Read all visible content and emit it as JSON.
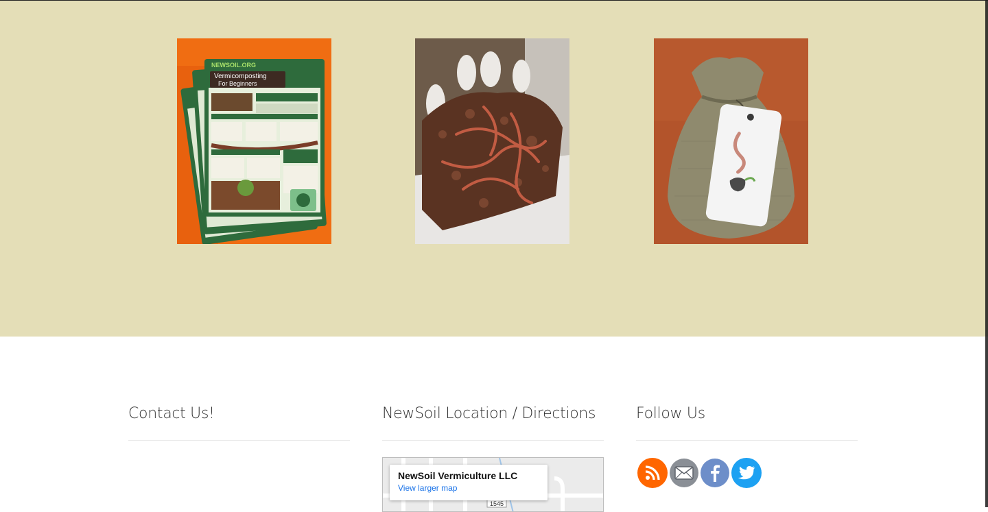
{
  "gallery": {
    "tiles": [
      {
        "title_line1": "NEWSOIL.ORG",
        "title_line2": "Vermicomposting",
        "title_line3": "For Beginners"
      },
      {},
      {}
    ]
  },
  "footer": {
    "contact": {
      "heading": "Contact Us!"
    },
    "location": {
      "heading": "NewSoil Location / Directions",
      "map_place": "NewSoil Vermiculture LLC",
      "map_link": "View larger map",
      "road_label": "1545"
    },
    "follow": {
      "heading": "Follow Us",
      "icons": [
        "rss-icon",
        "email-icon",
        "facebook-icon",
        "twitter-icon"
      ]
    }
  },
  "colors": {
    "band": "#e4deb7",
    "rss": "#ff6600",
    "email": "#8a8f96",
    "facebook": "#6d8ec9",
    "twitter": "#1da1f2",
    "link": "#1a73e8"
  }
}
